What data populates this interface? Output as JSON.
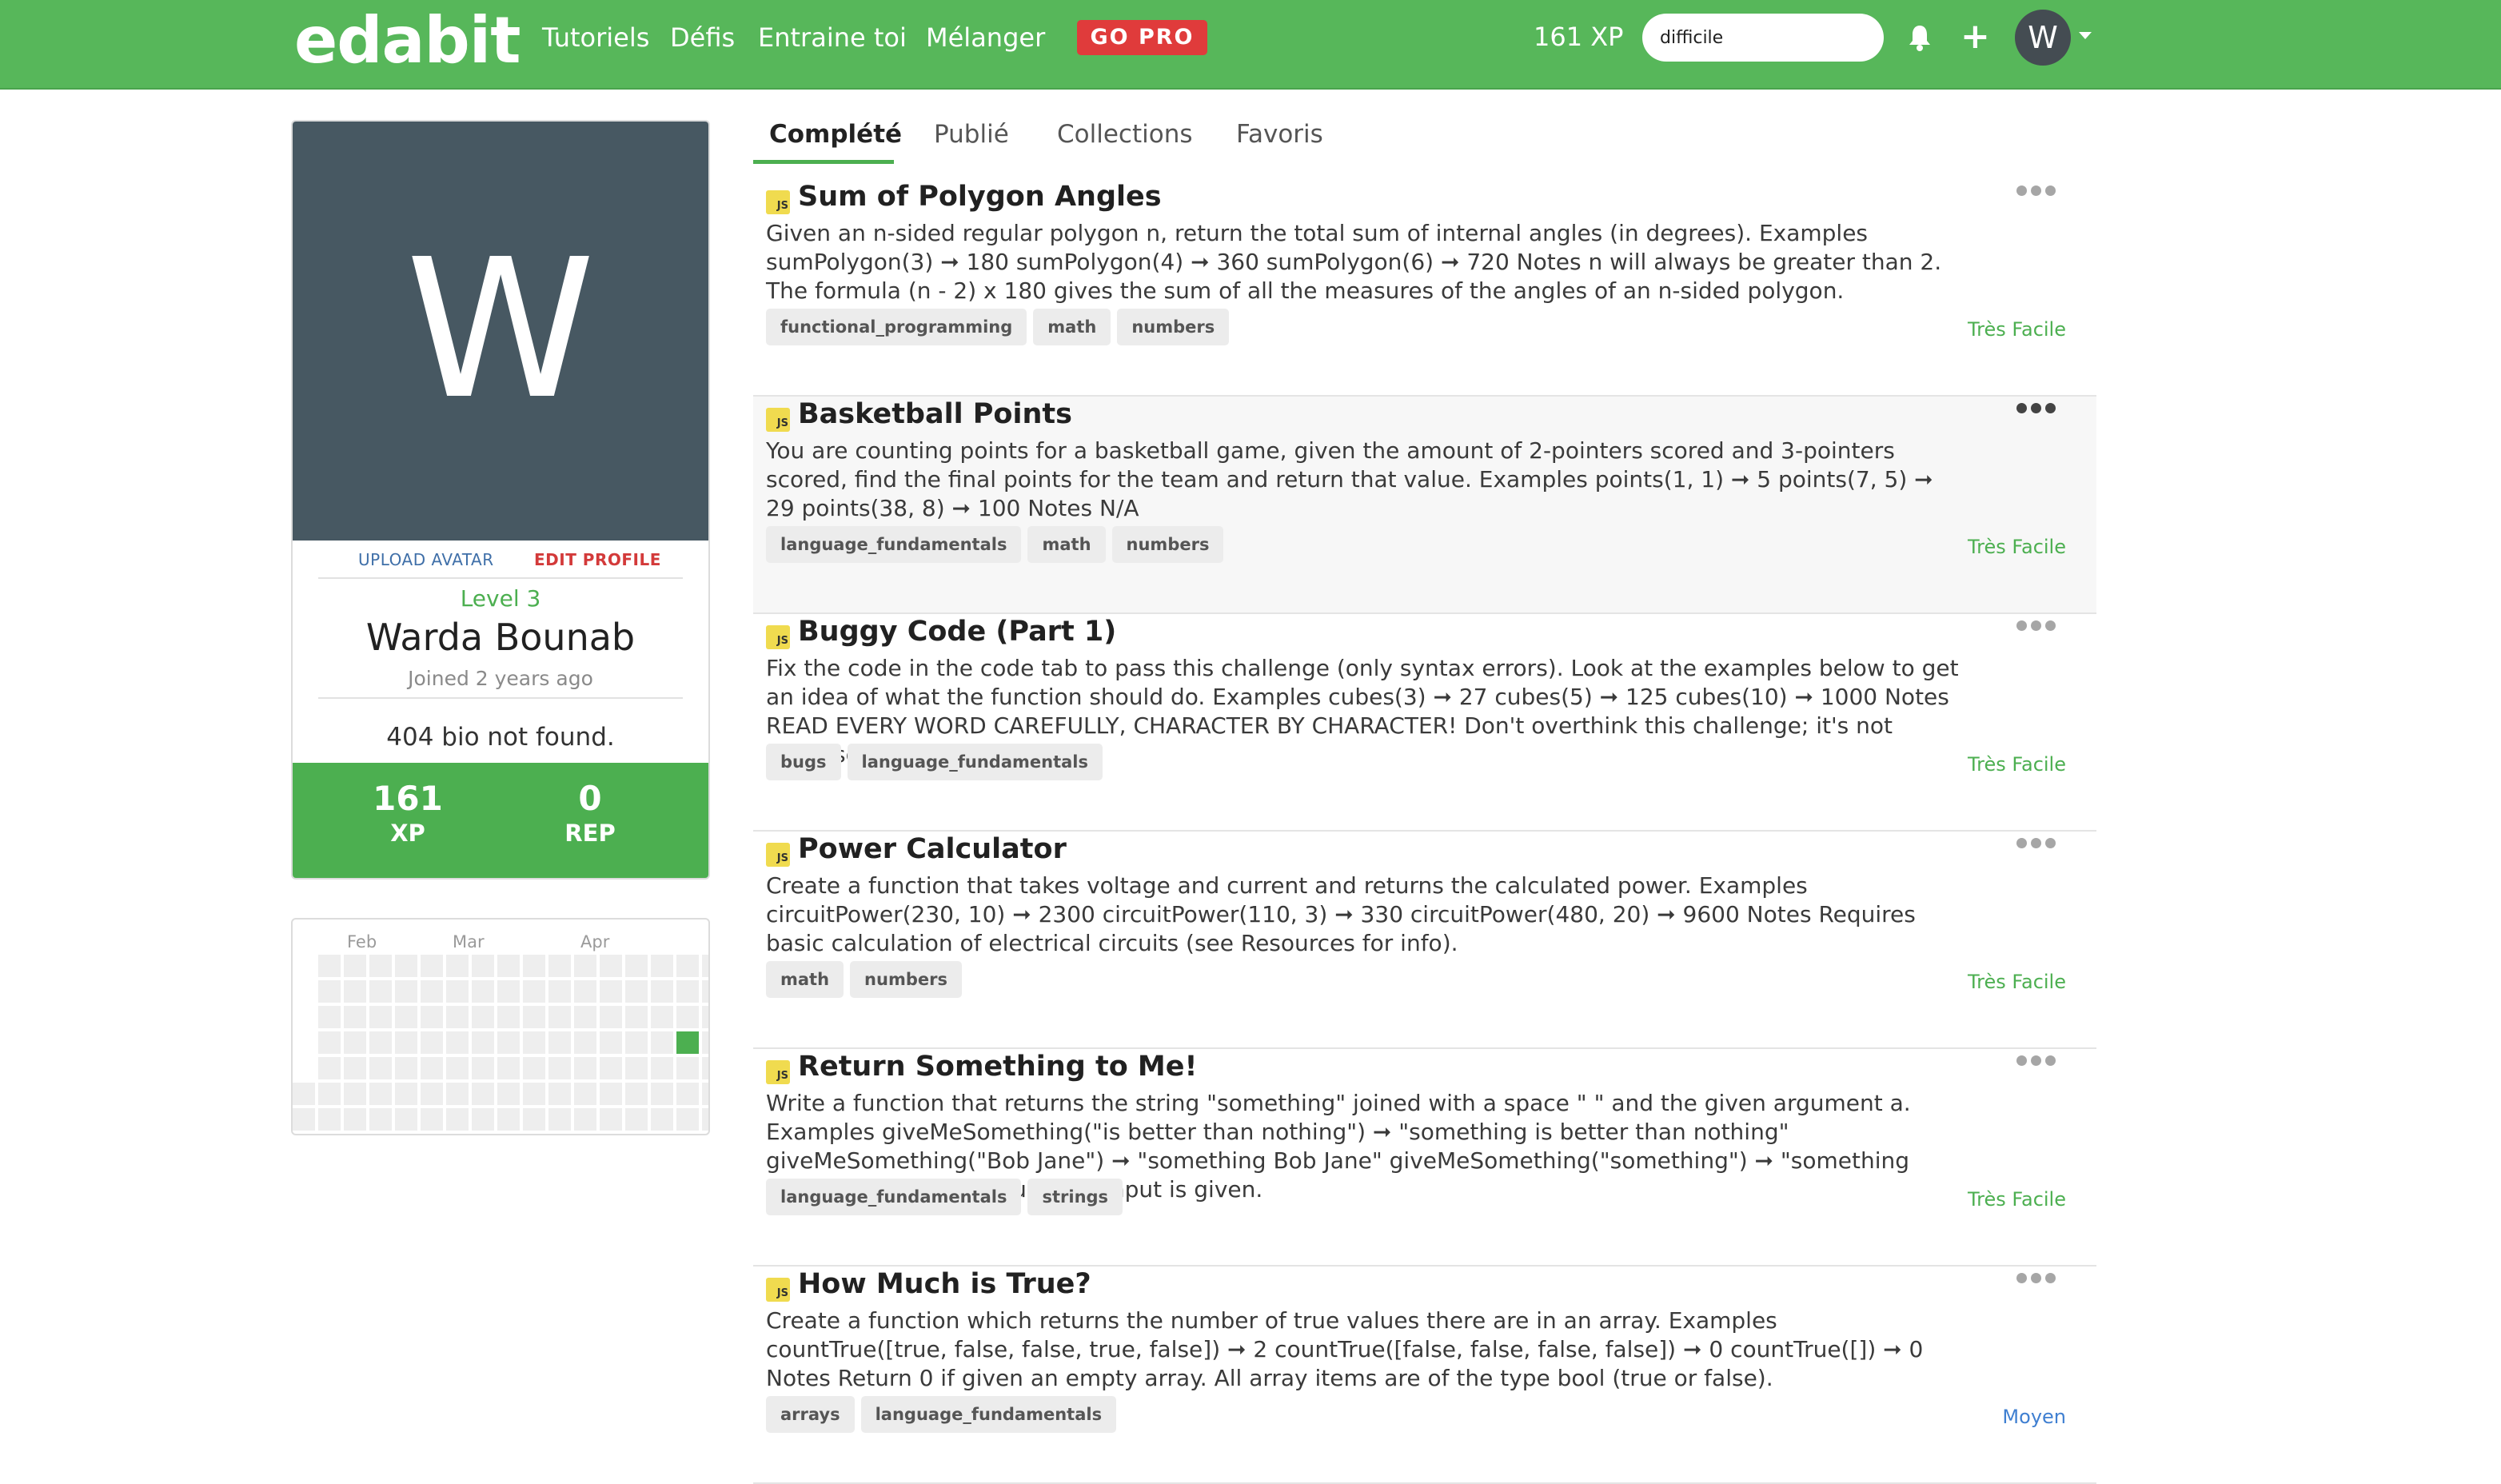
{
  "nav": {
    "logo": "edabit",
    "links": [
      "Tutoriels",
      "Défis",
      "Entraine toi",
      "Mélanger"
    ],
    "go_pro": "GO PRO",
    "xp": "161 XP",
    "search_value": "difficile",
    "avatar_initial": "W",
    "color_bar": "#57b75a"
  },
  "profile": {
    "avatar_letter": "W",
    "upload_avatar": "UPLOAD AVATAR",
    "edit_profile": "EDIT PROFILE",
    "level": "Level 3",
    "name": "Warda Bounab",
    "joined": "Joined 2 years ago",
    "bio": "404 bio not found.",
    "xp_value": "161",
    "xp_label": "XP",
    "rep_value": "0",
    "rep_label": "REP"
  },
  "calendar": {
    "months": [
      "Feb",
      "Mar",
      "Apr"
    ]
  },
  "tabs": [
    "Complété",
    "Publié",
    "Collections",
    "Favoris"
  ],
  "challenges": [
    {
      "lang": "JS",
      "title": "Sum of Polygon Angles",
      "description": "Given an n-sided regular polygon n, return the total sum of internal angles (in degrees). Examples sumPolygon(3) ➞ 180 sumPolygon(4) ➞ 360 sumPolygon(6) ➞ 720 Notes n will always be greater than 2. The formula (n - 2) x 180 gives the sum of all the measures of the angles of an n-sided polygon.",
      "tags": [
        "functional_programming",
        "math",
        "numbers"
      ],
      "difficulty": "Très Facile"
    },
    {
      "lang": "JS",
      "title": "Basketball Points",
      "description": "You are counting points for a basketball game, given the amount of 2-pointers scored and 3-pointers scored, find the final points for the team and return that value. Examples points(1, 1) ➞ 5 points(7, 5) ➞ 29 points(38, 8) ➞ 100 Notes N/A",
      "tags": [
        "language_fundamentals",
        "math",
        "numbers"
      ],
      "difficulty": "Très Facile"
    },
    {
      "lang": "JS",
      "title": "Buggy Code (Part 1)",
      "description": "Fix the code in the code tab to pass this challenge (only syntax errors). Look at the examples below to get an idea of what the function should do. Examples cubes(3) ➞ 27 cubes(5) ➞ 125 cubes(10) ➞ 1000 Notes READ EVERY WORD CAREFULLY, CHARACTER BY CHARACTER! Don't overthink this challenge; it's not supposed to be hard.",
      "tags": [
        "bugs",
        "language_fundamentals"
      ],
      "difficulty": "Très Facile"
    },
    {
      "lang": "JS",
      "title": "Power Calculator",
      "description": "Create a function that takes voltage and current and returns the calculated power. Examples circuitPower(230, 10) ➞ 2300 circuitPower(110, 3) ➞ 330 circuitPower(480, 20) ➞ 9600 Notes Requires basic calculation of electrical circuits (see Resources for info).",
      "tags": [
        "math",
        "numbers"
      ],
      "difficulty": "Très Facile"
    },
    {
      "lang": "JS",
      "title": "Return Something to Me!",
      "description": "Write a function that returns the string \"something\" joined with a space \" \" and the given argument a. Examples giveMeSomething(\"is better than nothing\") ➞ \"something is better than nothing\" giveMeSomething(\"Bob Jane\") ➞ \"something Bob Jane\" giveMeSomething(\"something\") ➞ \"something something\" Notes Assume an input is given.",
      "tags": [
        "language_fundamentals",
        "strings"
      ],
      "difficulty": "Très Facile"
    },
    {
      "lang": "JS",
      "title": "How Much is True?",
      "description": "Create a function which returns the number of true values there are in an array. Examples countTrue([true, false, false, true, false]) ➞ 2 countTrue([false, false, false, false]) ➞ 0 countTrue([]) ➞ 0 Notes Return 0 if given an empty array. All array items are of the type bool (true or false).",
      "tags": [
        "arrays",
        "language_fundamentals"
      ],
      "difficulty": "Moyen"
    }
  ]
}
